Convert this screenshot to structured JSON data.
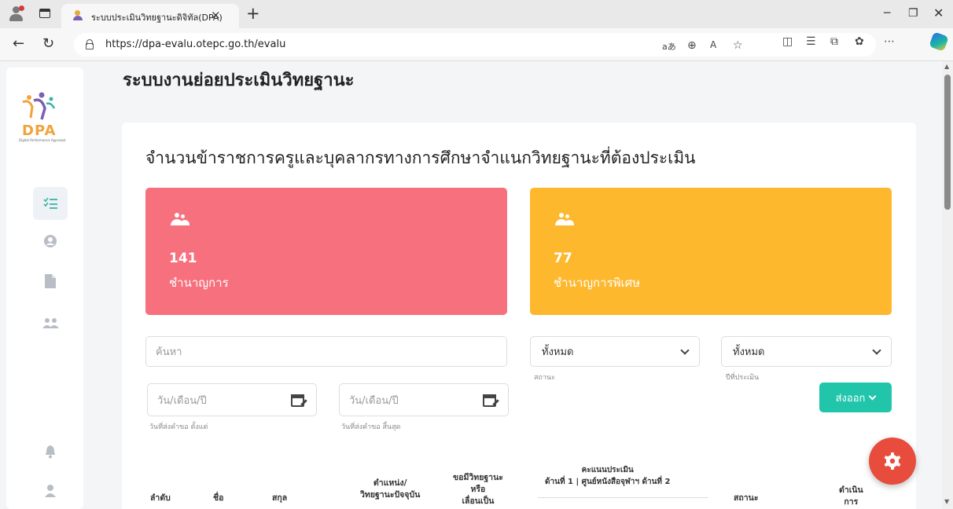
{
  "browser": {
    "tab_title": "ระบบประเมินวิทยฐานะดิจิทัล(DPA)",
    "tab_close": "×",
    "new_tab": "+",
    "url": "https://dpa-evalu.otepc.go.th/evalu",
    "read_aloud": "aあ"
  },
  "page": {
    "title": "ระบบงานย่อยประเมินวิทยฐานะ",
    "logo_text": "DPA",
    "logo_subtext": "Digital Performance Appraisal",
    "card_title": "จำนวนข้าราชการครูและบุคลากรทางการศึกษาจำแนกวิทยฐานะที่ต้องประเมิน"
  },
  "stats": [
    {
      "count": "141",
      "label": "ชำนาญการ",
      "color": "#f7707d"
    },
    {
      "count": "77",
      "label": "ชำนาญการพิเศษ",
      "color": "#fdb82e"
    }
  ],
  "filters": {
    "search_placeholder": "ค้นหา",
    "status_value": "ทั้งหมด",
    "status_hint": "สถานะ",
    "year_value": "ทั้งหมด",
    "year_hint": "ปีที่ประเมิน",
    "date_from_placeholder": "วัน/เดือน/ปี",
    "date_from_hint": "วันที่ส่งคำขอ ตั้งแต่",
    "date_to_placeholder": "วัน/เดือน/ปี",
    "date_to_hint": "วันที่ส่งคำขอ สิ้นสุด",
    "export_label": "ส่งออก"
  },
  "table": {
    "col_order": "ลำดับ",
    "col_name": "ชื่อ",
    "col_surname": "สกุล",
    "col_position_1": "ตำแหน่ง/",
    "col_position_2": "วิทยฐานะปัจจุบัน",
    "col_request_1": "ขอมีวิทยฐานะ",
    "col_request_2": "หรือ",
    "col_request_3": "เลื่อนเป็น",
    "col_score_title": "คะแนนประเมิน",
    "col_score_sub": "ด้านที่ 1 | ศูนย์หนังสือจุฬาฯ ด้านที่ 2",
    "col_status": "สถานะ",
    "col_action_1": "ดำเนิน",
    "col_action_2": "การ"
  },
  "colors": {
    "accent": "#20c5aa",
    "fab": "#e74c3c"
  }
}
